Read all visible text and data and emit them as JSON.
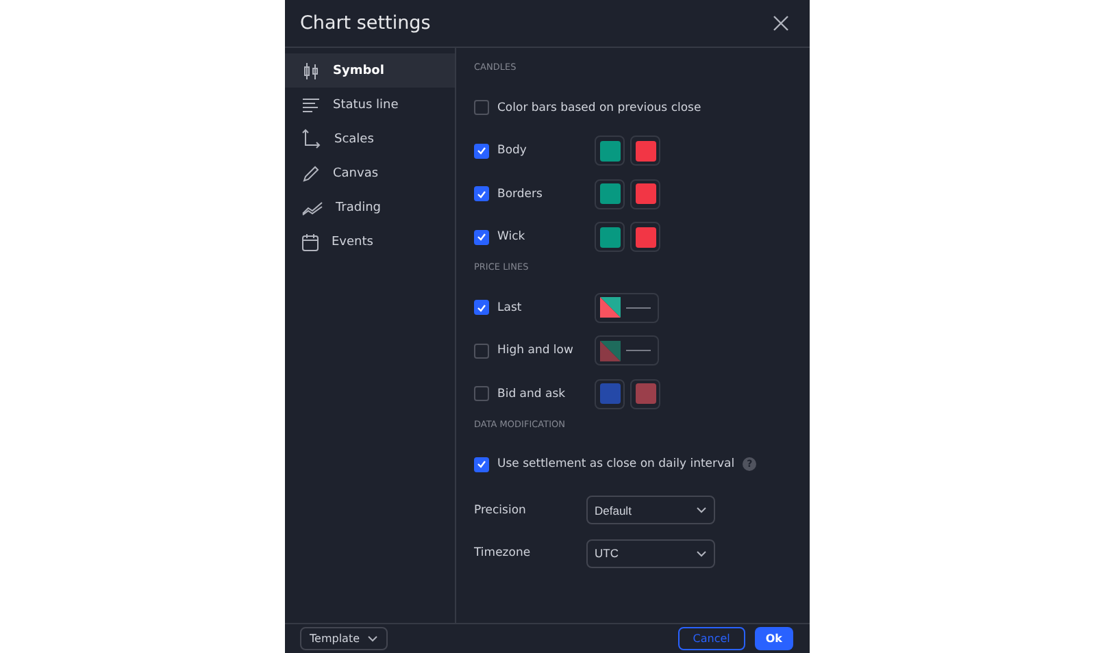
{
  "dialog": {
    "title": "Chart settings"
  },
  "sidebar": {
    "items": [
      {
        "kind": "candles",
        "label": "Symbol",
        "selected": true
      },
      {
        "kind": "lines",
        "label": "Status line",
        "selected": false
      },
      {
        "kind": "scales",
        "label": "Scales",
        "selected": false
      },
      {
        "kind": "pencil",
        "label": "Canvas",
        "selected": false
      },
      {
        "kind": "trading",
        "label": "Trading",
        "selected": false
      },
      {
        "kind": "calendar",
        "label": "Events",
        "selected": false
      }
    ]
  },
  "sections": [
    {
      "heading": "CANDLES",
      "rows": [
        {
          "label": "Color bars based on previous close",
          "checked": false,
          "swatches": []
        },
        {
          "label": "Body",
          "checked": true,
          "swatches": [
            {
              "kind": "solid",
              "color": "#089981"
            },
            {
              "kind": "solid",
              "color": "#f23645"
            }
          ]
        },
        {
          "label": "Borders",
          "checked": true,
          "swatches": [
            {
              "kind": "solid",
              "color": "#089981"
            },
            {
              "kind": "solid",
              "color": "#f23645"
            }
          ]
        },
        {
          "label": "Wick",
          "checked": true,
          "swatches": [
            {
              "kind": "solid",
              "color": "#089981"
            },
            {
              "kind": "solid",
              "color": "#f23645"
            }
          ]
        }
      ]
    },
    {
      "heading": "PRICE LINES",
      "rows": [
        {
          "label": "Last",
          "checked": true,
          "swatches": [
            {
              "kind": "split-line",
              "halves": [
                {
                  "color": "#22ab94"
                },
                {
                  "color": "#f7525f"
                }
              ]
            }
          ]
        },
        {
          "label": "High and low",
          "checked": false,
          "swatches": [
            {
              "kind": "split-line",
              "halves": [
                {
                  "color": "#1e6b5c"
                },
                {
                  "color": "#8c3a45"
                }
              ]
            }
          ]
        },
        {
          "label": "Bid and ask",
          "checked": false,
          "swatches": [
            {
              "kind": "solid",
              "color": "#2549a8"
            },
            {
              "kind": "solid",
              "color": "#9b3f4b"
            }
          ]
        }
      ]
    },
    {
      "heading": "DATA MODIFICATION",
      "rows": [
        {
          "label": "Use settlement as close on daily interval",
          "checked": true,
          "help": "?",
          "swatches": []
        }
      ]
    }
  ],
  "selects": [
    {
      "label": "Precision",
      "value": "Default"
    },
    {
      "label": "Timezone",
      "value": "UTC"
    }
  ],
  "footer": {
    "template": "Template",
    "cancel": "Cancel",
    "ok": "Ok"
  }
}
